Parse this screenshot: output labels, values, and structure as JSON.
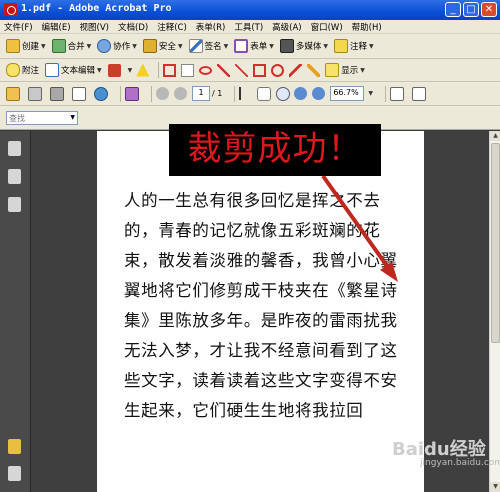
{
  "window": {
    "title": "1.pdf - Adobe Acrobat Pro",
    "btn_min": "_",
    "btn_max": "□",
    "btn_close": "✕"
  },
  "menu": [
    "文件(F)",
    "编辑(E)",
    "视图(V)",
    "文档(D)",
    "注释(C)",
    "表单(R)",
    "工具(T)",
    "高级(A)",
    "窗口(W)",
    "帮助(H)"
  ],
  "toolbar1": {
    "create": "创建",
    "combine": "合并",
    "collaborate": "协作",
    "secure": "安全",
    "sign": "签名",
    "forms": "表单",
    "multimedia": "多媒体",
    "comment": "注释"
  },
  "toolbar2": {
    "attach": "附注",
    "text_edit": "文本编辑",
    "show": "显示"
  },
  "toolbar3": {
    "page_current": "1",
    "page_total": "/ 1",
    "zoom": "66.7%"
  },
  "find": {
    "placeholder": "查找"
  },
  "banner": "裁剪成功！",
  "page_lines": [
    "人的一生总有很多回忆是挥之不去",
    "的，青春的记忆就像五彩斑斓的花",
    "束，散发着淡雅的馨香，我曾小心翼",
    "翼地将它们修剪成干枝夹在《繁星诗",
    "集》里陈放多年。是昨夜的雷雨扰我",
    "无法入梦，才让我不经意间看到了这",
    "些文字，读着读着这些文字变得不安",
    "生起来，它们硬生生地将我拉回"
  ],
  "watermark": "Baidu经验",
  "watermark_sub": "jingyan.baidu.com",
  "colors": {
    "banner_text": "#e0171c",
    "arrow": "#c0281e",
    "title_bar": "#0a4fd6"
  }
}
